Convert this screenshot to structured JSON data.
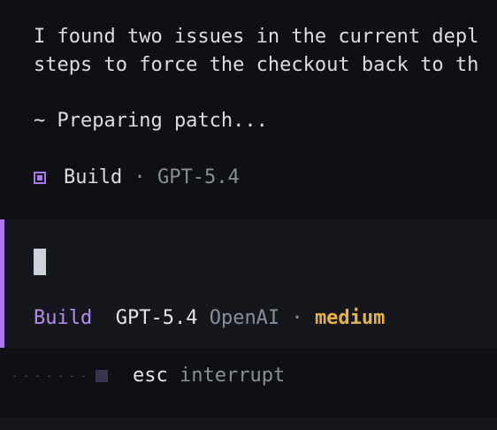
{
  "messages": {
    "line1": "I found two issues in the current depl",
    "line2": "steps to force the checkout back to th",
    "status": "~ Preparing patch..."
  },
  "agent_row": {
    "icon": "agent-square-icon",
    "mode": "Build",
    "separator": "·",
    "model": "GPT-5.4"
  },
  "input": {
    "mode": "Build",
    "model": "GPT-5.4",
    "provider": "OpenAI",
    "separator": "·",
    "effort": "medium"
  },
  "footer": {
    "key": "esc",
    "action": "interrupt"
  },
  "colors": {
    "background": "#0f1014",
    "panel": "#16171d",
    "accent": "#a777ee",
    "effort": "#e3b24c"
  }
}
